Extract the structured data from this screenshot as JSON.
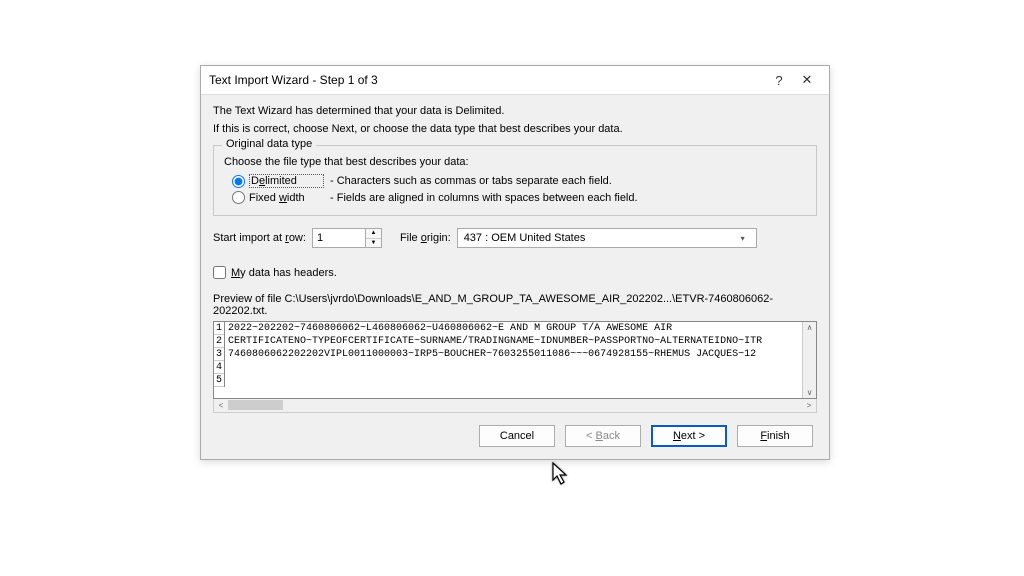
{
  "dialog": {
    "title": "Text Import Wizard - Step 1 of 3",
    "intro1": "The Text Wizard has determined that your data is Delimited.",
    "intro2": "If this is correct, choose Next, or choose the data type that best describes your data.",
    "group": {
      "legend": "Original data type",
      "choose": "Choose the file type that best describes your data:",
      "delimited": {
        "label_pre": "D",
        "label_ul": "e",
        "label_post": "limited",
        "desc": "- Characters such as commas or tabs separate each field."
      },
      "fixed": {
        "label_pre": "Fixed ",
        "label_ul": "w",
        "label_post": "idth",
        "desc": "- Fields are aligned in columns with spaces between each field."
      }
    },
    "startRow": {
      "label_pre": "Start import at ",
      "label_ul": "r",
      "label_post": "ow:",
      "value": "1"
    },
    "origin": {
      "label_pre": "File ",
      "label_ul": "o",
      "label_post": "rigin:",
      "value": "437 : OEM United States"
    },
    "headers": {
      "label_ul": "M",
      "label_post": "y data has headers."
    },
    "previewLabel": "Preview of file C:\\Users\\jvrdo\\Downloads\\E_AND_M_GROUP_TA_AWESOME_AIR_202202...\\ETVR-7460806062-202202.txt.",
    "previewLines": [
      "2022~202202~7460806062~L460806062~U460806062~E AND M GROUP T/A AWESOME AIR",
      "CERTIFICATENO~TYPEOFCERTIFICATE~SURNAME/TRADINGNAME~IDNUMBER~PASSPORTNO~ALTERNATEIDNO~ITR",
      "7460806062202202VIPL0011000003~IRP5~BOUCHER~7603255011086~~~0674928155~RHEMUS JACQUES~12",
      "",
      ""
    ],
    "lineNums": [
      "1",
      "2",
      "3",
      "4",
      "5"
    ],
    "buttons": {
      "cancel": "Cancel",
      "back_pre": "< ",
      "back_ul": "B",
      "back_post": "ack",
      "next_ul": "N",
      "next_post": "ext >",
      "finish_ul": "F",
      "finish_post": "inish"
    }
  }
}
